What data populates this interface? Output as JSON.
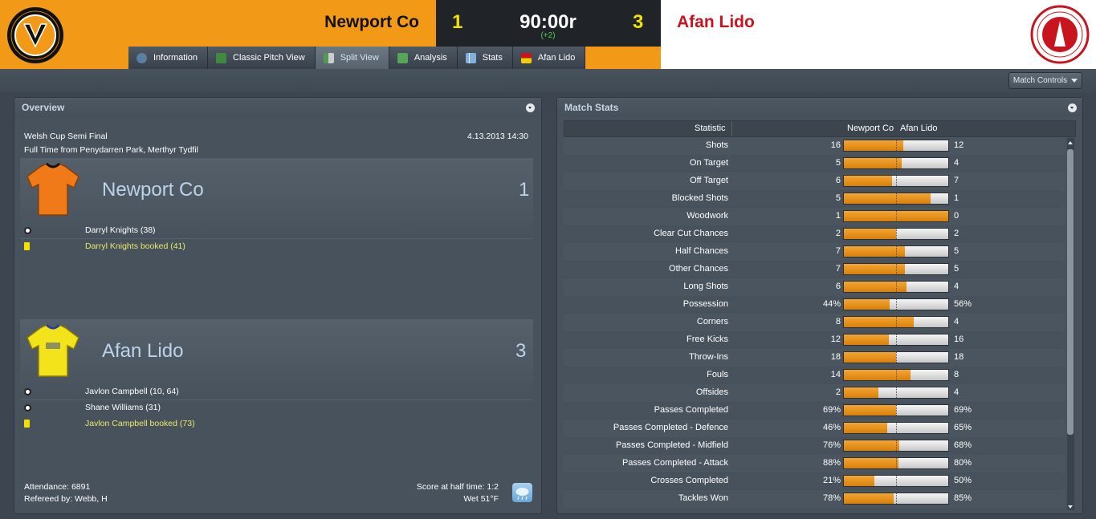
{
  "match": {
    "home_team": "Newport Co",
    "away_team": "Afan Lido",
    "home_score": "1",
    "away_score": "3",
    "clock": "90:00r",
    "stoppage": "(+2)"
  },
  "tabs": [
    {
      "label": "Information",
      "icon": "info-icon"
    },
    {
      "label": "Classic Pitch View",
      "icon": "pitch-icon"
    },
    {
      "label": "Split View",
      "icon": "split-view-icon"
    },
    {
      "label": "Analysis",
      "icon": "analysis-icon"
    },
    {
      "label": "Stats",
      "icon": "stats-icon"
    },
    {
      "label": "Afan Lido",
      "icon": "team-icon"
    }
  ],
  "active_tab": "Split View",
  "match_controls_label": "Match Controls",
  "overview": {
    "title": "Overview",
    "competition": "Welsh Cup Semi Final",
    "date": "4.13.2013 14:30",
    "venue": "Full Time from Penydarren Park, Merthyr Tydfil",
    "home": {
      "name": "Newport Co",
      "score": "1",
      "events": [
        {
          "type": "goal",
          "text": "Darryl Knights (38)"
        },
        {
          "type": "booking",
          "text": "Darryl Knights booked (41)"
        }
      ]
    },
    "away": {
      "name": "Afan Lido",
      "score": "3",
      "events": [
        {
          "type": "goal",
          "text": "Javlon Campbell (10, 64)"
        },
        {
          "type": "goal",
          "text": "Shane Williams (31)"
        },
        {
          "type": "booking",
          "text": "Javlon Campbell booked (73)"
        }
      ]
    },
    "attendance": "Attendance: 6891",
    "referee": "Refereed by: Webb, H",
    "half_time": "Score at half time: 1:2",
    "weather": "Wet 51°F",
    "weather_icon": "rain-cloud-icon"
  },
  "stats": {
    "title": "Match Stats",
    "col_statistic": "Statistic",
    "col_home": "Newport Co",
    "col_away": "Afan Lido",
    "rows": [
      {
        "label": "Shots",
        "home": "16",
        "away": "12",
        "home_share": 0.571
      },
      {
        "label": "On Target",
        "home": "5",
        "away": "4",
        "home_share": 0.556
      },
      {
        "label": "Off Target",
        "home": "6",
        "away": "7",
        "home_share": 0.462
      },
      {
        "label": "Blocked Shots",
        "home": "5",
        "away": "1",
        "home_share": 0.833
      },
      {
        "label": "Woodwork",
        "home": "1",
        "away": "0",
        "home_share": 1.0
      },
      {
        "label": "Clear Cut Chances",
        "home": "2",
        "away": "2",
        "home_share": 0.5
      },
      {
        "label": "Half Chances",
        "home": "7",
        "away": "5",
        "home_share": 0.583
      },
      {
        "label": "Other Chances",
        "home": "7",
        "away": "5",
        "home_share": 0.583
      },
      {
        "label": "Long Shots",
        "home": "6",
        "away": "4",
        "home_share": 0.6
      },
      {
        "label": "Possession",
        "home": "44%",
        "away": "56%",
        "home_share": 0.44
      },
      {
        "label": "Corners",
        "home": "8",
        "away": "4",
        "home_share": 0.667
      },
      {
        "label": "Free Kicks",
        "home": "12",
        "away": "16",
        "home_share": 0.429
      },
      {
        "label": "Throw-Ins",
        "home": "18",
        "away": "18",
        "home_share": 0.5
      },
      {
        "label": "Fouls",
        "home": "14",
        "away": "8",
        "home_share": 0.636
      },
      {
        "label": "Offsides",
        "home": "2",
        "away": "4",
        "home_share": 0.333
      },
      {
        "label": "Passes Completed",
        "home": "69%",
        "away": "69%",
        "home_share": 0.5
      },
      {
        "label": "Passes Completed - Defence",
        "home": "46%",
        "away": "65%",
        "home_share": 0.414
      },
      {
        "label": "Passes Completed - Midfield",
        "home": "76%",
        "away": "68%",
        "home_share": 0.528
      },
      {
        "label": "Passes Completed - Attack",
        "home": "88%",
        "away": "80%",
        "home_share": 0.524
      },
      {
        "label": "Crosses Completed",
        "home": "21%",
        "away": "50%",
        "home_share": 0.296
      },
      {
        "label": "Tackles Won",
        "home": "78%",
        "away": "85%",
        "home_share": 0.479
      }
    ]
  },
  "colors": {
    "home_orange": "#f29a18",
    "away_red": "#c8141e",
    "score_yellow": "#f4e000",
    "stoppage_green": "#4cd14c"
  }
}
